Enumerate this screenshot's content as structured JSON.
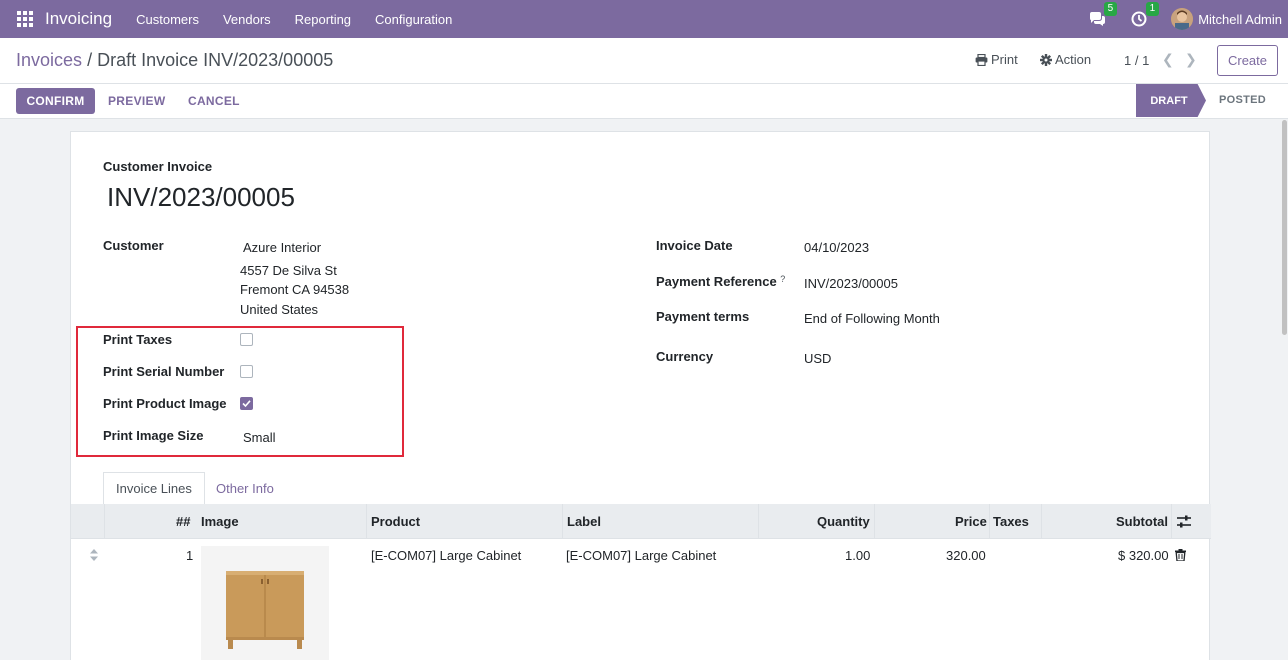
{
  "navbar": {
    "app_name": "Invoicing",
    "menu": [
      "Customers",
      "Vendors",
      "Reporting",
      "Configuration"
    ],
    "messages_badge": "5",
    "activities_badge": "1",
    "user_name": "Mitchell Admin",
    "bg_color": "#7c6a9f"
  },
  "control_panel": {
    "breadcrumb_parent": "Invoices",
    "breadcrumb_sep": "/",
    "breadcrumb_current": "Draft Invoice INV/2023/00005",
    "print_label": "Print",
    "action_label": "Action",
    "pager": "1 / 1",
    "create_label": "Create"
  },
  "statusbar": {
    "confirm_label": "CONFIRM",
    "preview_label": "PREVIEW",
    "cancel_label": "CANCEL",
    "stage_draft": "DRAFT",
    "stage_posted": "POSTED"
  },
  "form": {
    "type_label": "Customer Invoice",
    "number": "INV/2023/00005",
    "customer_label": "Customer",
    "customer_name": "Azure Interior",
    "address_line1": "4557 De Silva St",
    "address_line2": "Fremont CA 94538",
    "address_line3": "United States",
    "print_taxes_label": "Print Taxes",
    "print_taxes": false,
    "print_serial_label": "Print Serial Number",
    "print_serial": false,
    "print_image_label": "Print Product Image",
    "print_image": true,
    "image_size_label": "Print Image Size",
    "image_size": "Small",
    "invoice_date_label": "Invoice Date",
    "invoice_date": "04/10/2023",
    "payment_ref_label": "Payment Reference",
    "payment_ref_help": "?",
    "payment_ref": "INV/2023/00005",
    "payment_terms_label": "Payment terms",
    "payment_terms": "End of Following Month",
    "currency_label": "Currency",
    "currency": "USD"
  },
  "tabs": {
    "invoice_lines": "Invoice Lines",
    "other_info": "Other Info"
  },
  "table": {
    "headers": {
      "number": "##",
      "image": "Image",
      "product": "Product",
      "label": "Label",
      "quantity": "Quantity",
      "price": "Price",
      "taxes": "Taxes",
      "subtotal": "Subtotal"
    },
    "rows": [
      {
        "number": "1",
        "product": "[E-COM07] Large Cabinet",
        "label": "[E-COM07] Large Cabinet",
        "quantity": "1.00",
        "price": "320.00",
        "taxes": "",
        "subtotal": "$ 320.00"
      }
    ]
  }
}
